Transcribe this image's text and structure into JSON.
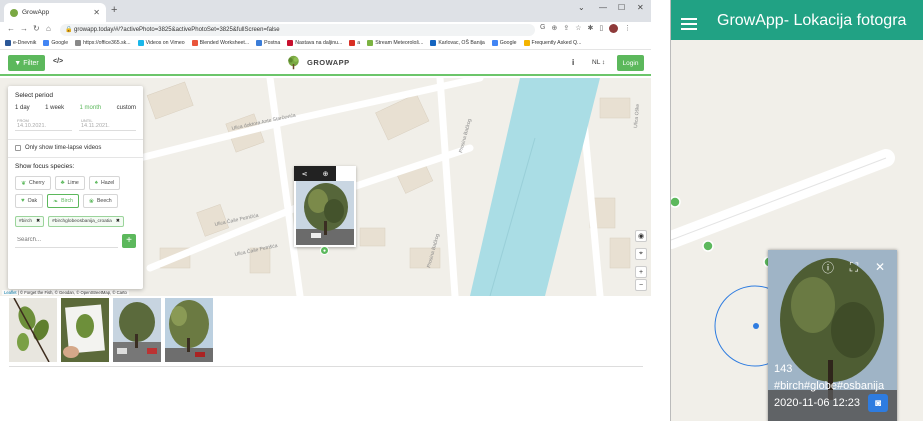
{
  "browser": {
    "tab_title": "GrowApp",
    "url": "growapp.today/#/?activePhoto=3825&activePhotoSet=3825&fullScreen=false",
    "bookmarks": [
      "e-Dnevnik",
      "Google",
      "https://office365.sk...",
      "Videos on Vimeo",
      "Blended Worksheet...",
      "Postna",
      "Nastava na daljinu...",
      "a",
      "Stream Meteorološ...",
      "Karlovac, OŠ Banija",
      "Google",
      "Frequently Asked Q..."
    ]
  },
  "app_header": {
    "filter_label": "Filter",
    "code_label": "</>",
    "brand": "GROWAPP",
    "info_label": "i",
    "language": "NL ↕",
    "login_label": "Login"
  },
  "filter_panel": {
    "title": "Select period",
    "periods": [
      "1 day",
      "1 week",
      "1 month",
      "custom"
    ],
    "from_label": "FROM",
    "from_value": "14.10.2021.",
    "until_label": "UNTIL",
    "until_value": "14.11.2021.",
    "timelapse_label": "Only show time-lapse videos",
    "species_title": "Show focus species:",
    "species": [
      "Cherry",
      "Lime",
      "Hazel",
      "Oak",
      "Birch",
      "Beech"
    ],
    "tags": [
      "#birch",
      "#birchglobeosbanija_croatia"
    ],
    "search_placeholder": "Search...",
    "add_label": "+"
  },
  "map": {
    "street_labels": [
      "Ulica doktora Ante Starčevića",
      "Ulica Čaše Petričića",
      "Ulica Čaše Petrišća",
      "Prosina Bačkog",
      "Prosina Bačkog",
      "Ulica Oške"
    ],
    "attribution_leaflet": "Leaflet",
    "attribution_text": " | © Forget the Fish, © Geodan, © OpenStreetMap, © Carto"
  },
  "mobile": {
    "title": "GrowApp- Lokacija fotogra",
    "photo_number": "143",
    "photo_tags": "#birch#globe#osbanija",
    "photo_date": "2020-11-06 12:23"
  },
  "colors": {
    "brand_green": "#5cb85c",
    "mobile_header": "#21a284",
    "river": "#aadde5"
  }
}
